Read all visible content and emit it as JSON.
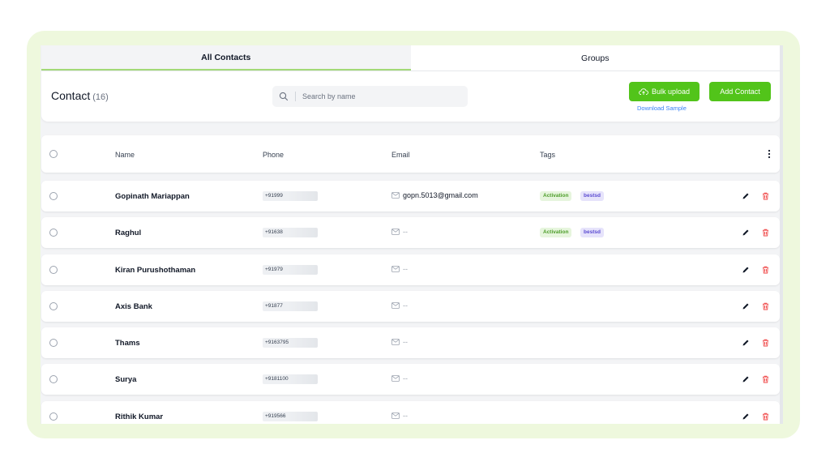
{
  "tabs": [
    {
      "label": "All Contacts",
      "active": true
    },
    {
      "label": "Groups",
      "active": false
    }
  ],
  "toolbar": {
    "title": "Contact",
    "count": "(16)",
    "search_placeholder": "Search by name",
    "bulk_upload_label": "Bulk upload",
    "download_sample_label": "Download Sample",
    "add_contact_label": "Add Contact"
  },
  "table": {
    "columns": [
      "Name",
      "Phone",
      "Email",
      "Tags"
    ],
    "rows": [
      {
        "name": "Gopinath Mariappan",
        "phone": "+91999",
        "email": "gopn.5013@gmail.com",
        "tags": [
          "Activation",
          "bestsd"
        ]
      },
      {
        "name": "Raghul",
        "phone": "+91638",
        "email": "--",
        "tags": [
          "Activation",
          "bestsd"
        ]
      },
      {
        "name": "Kiran Purushothaman",
        "phone": "+91979",
        "email": "--",
        "tags": []
      },
      {
        "name": "Axis Bank",
        "phone": "+91877",
        "email": "--",
        "tags": []
      },
      {
        "name": "Thams",
        "phone": "+9163795",
        "email": "--",
        "tags": []
      },
      {
        "name": "Surya",
        "phone": "+9181100",
        "email": "--",
        "tags": []
      },
      {
        "name": "Rithik Kumar",
        "phone": "+919566",
        "email": "--",
        "tags": []
      }
    ]
  },
  "colors": {
    "accent": "#52c41a",
    "frame": "#eef8dd",
    "delete": "#ef4444",
    "link": "#3b82f6"
  },
  "icons": {
    "search": "search-icon",
    "upload": "cloud-upload-icon",
    "mail": "mail-icon",
    "edit": "pencil-icon",
    "delete": "trash-icon",
    "menu": "kebab-menu-icon"
  }
}
